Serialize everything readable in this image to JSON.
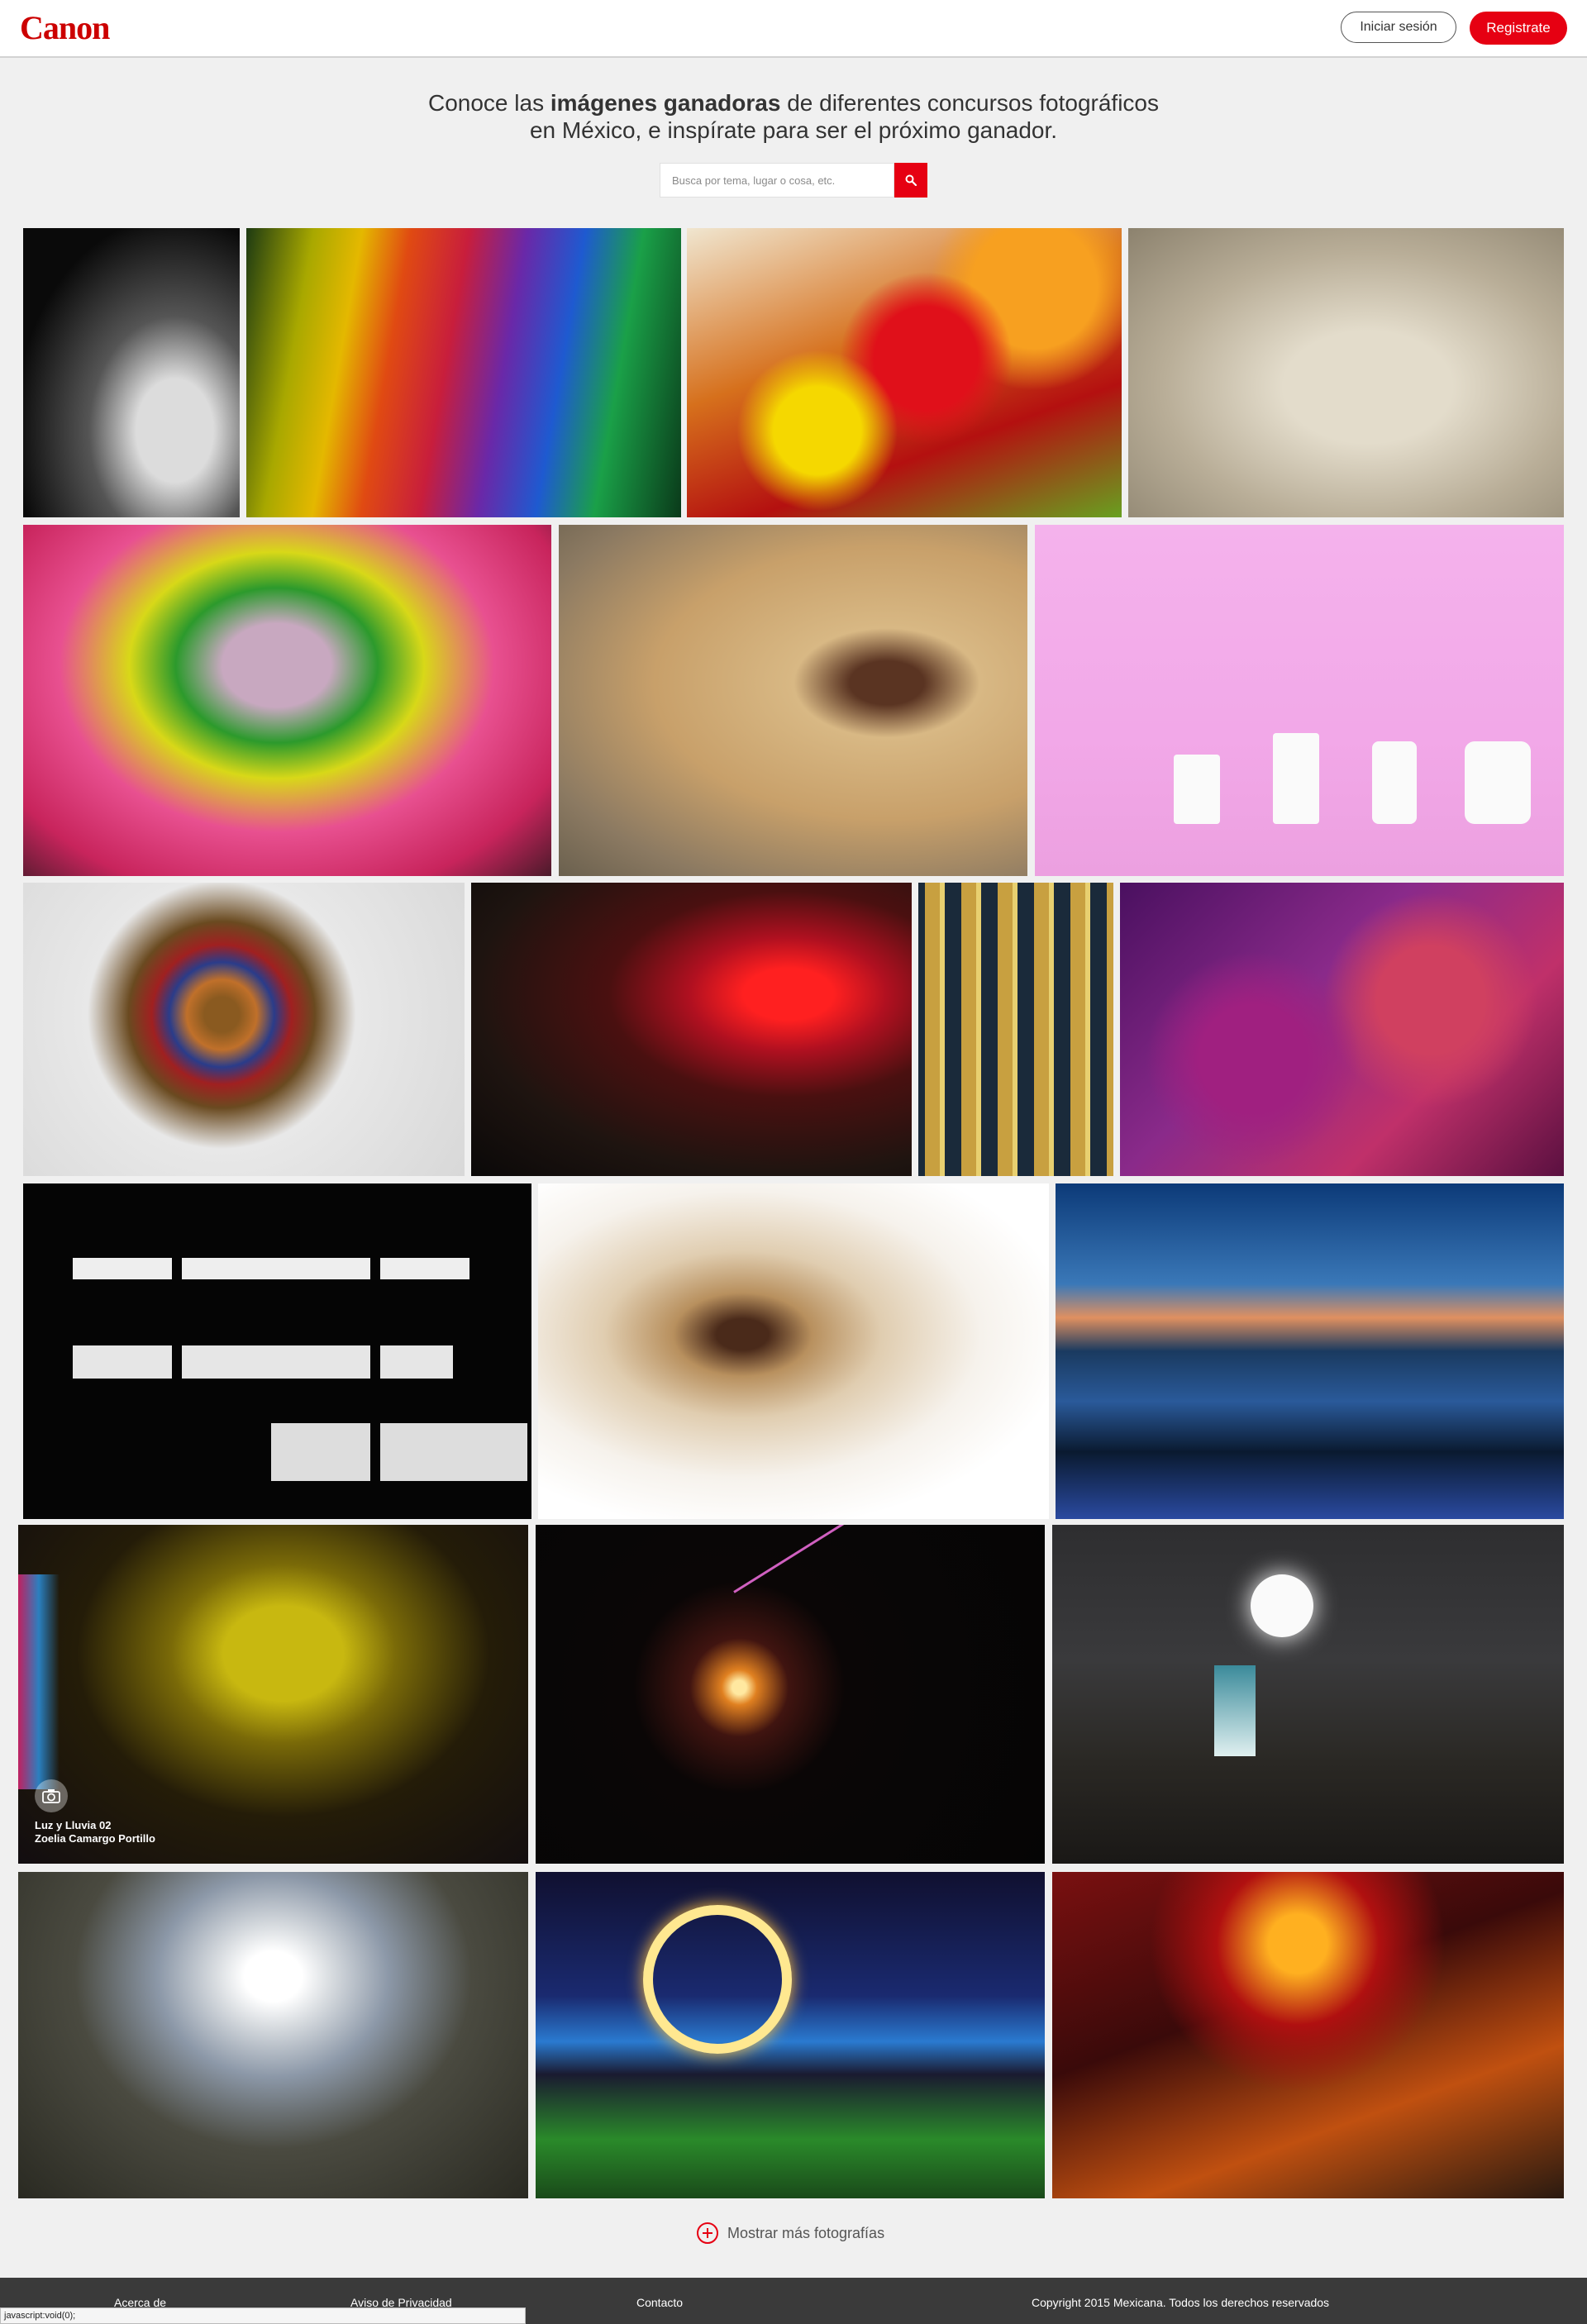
{
  "header": {
    "logo": "Canon",
    "login_label": "Iniciar sesión",
    "register_label": "Registrate"
  },
  "intro": {
    "line1_pre": "Conoce las ",
    "line1_bold": "imágenes ganadoras",
    "line1_post": " de diferentes concursos fotográficos",
    "line2": "en México, e inspírate para ser el próximo ganador."
  },
  "search": {
    "placeholder": "Busca por tema, lugar o cosa, etc."
  },
  "gallery": {
    "featured_caption": {
      "title": "Luz y Lluvia 02",
      "author": "Zoelia Camargo Portillo"
    }
  },
  "show_more_label": "Mostrar más fotografías",
  "footer": {
    "about": "Acerca de",
    "privacy": "Aviso de Privacidad",
    "contact": "Contacto",
    "copyright": "Copyright 2015 Mexicana. Todos los derechos reservados"
  },
  "status_bar_text": "javascript:void(0);",
  "colors": {
    "brand_red": "#e60012",
    "footer_bg": "#3a3a3a"
  }
}
